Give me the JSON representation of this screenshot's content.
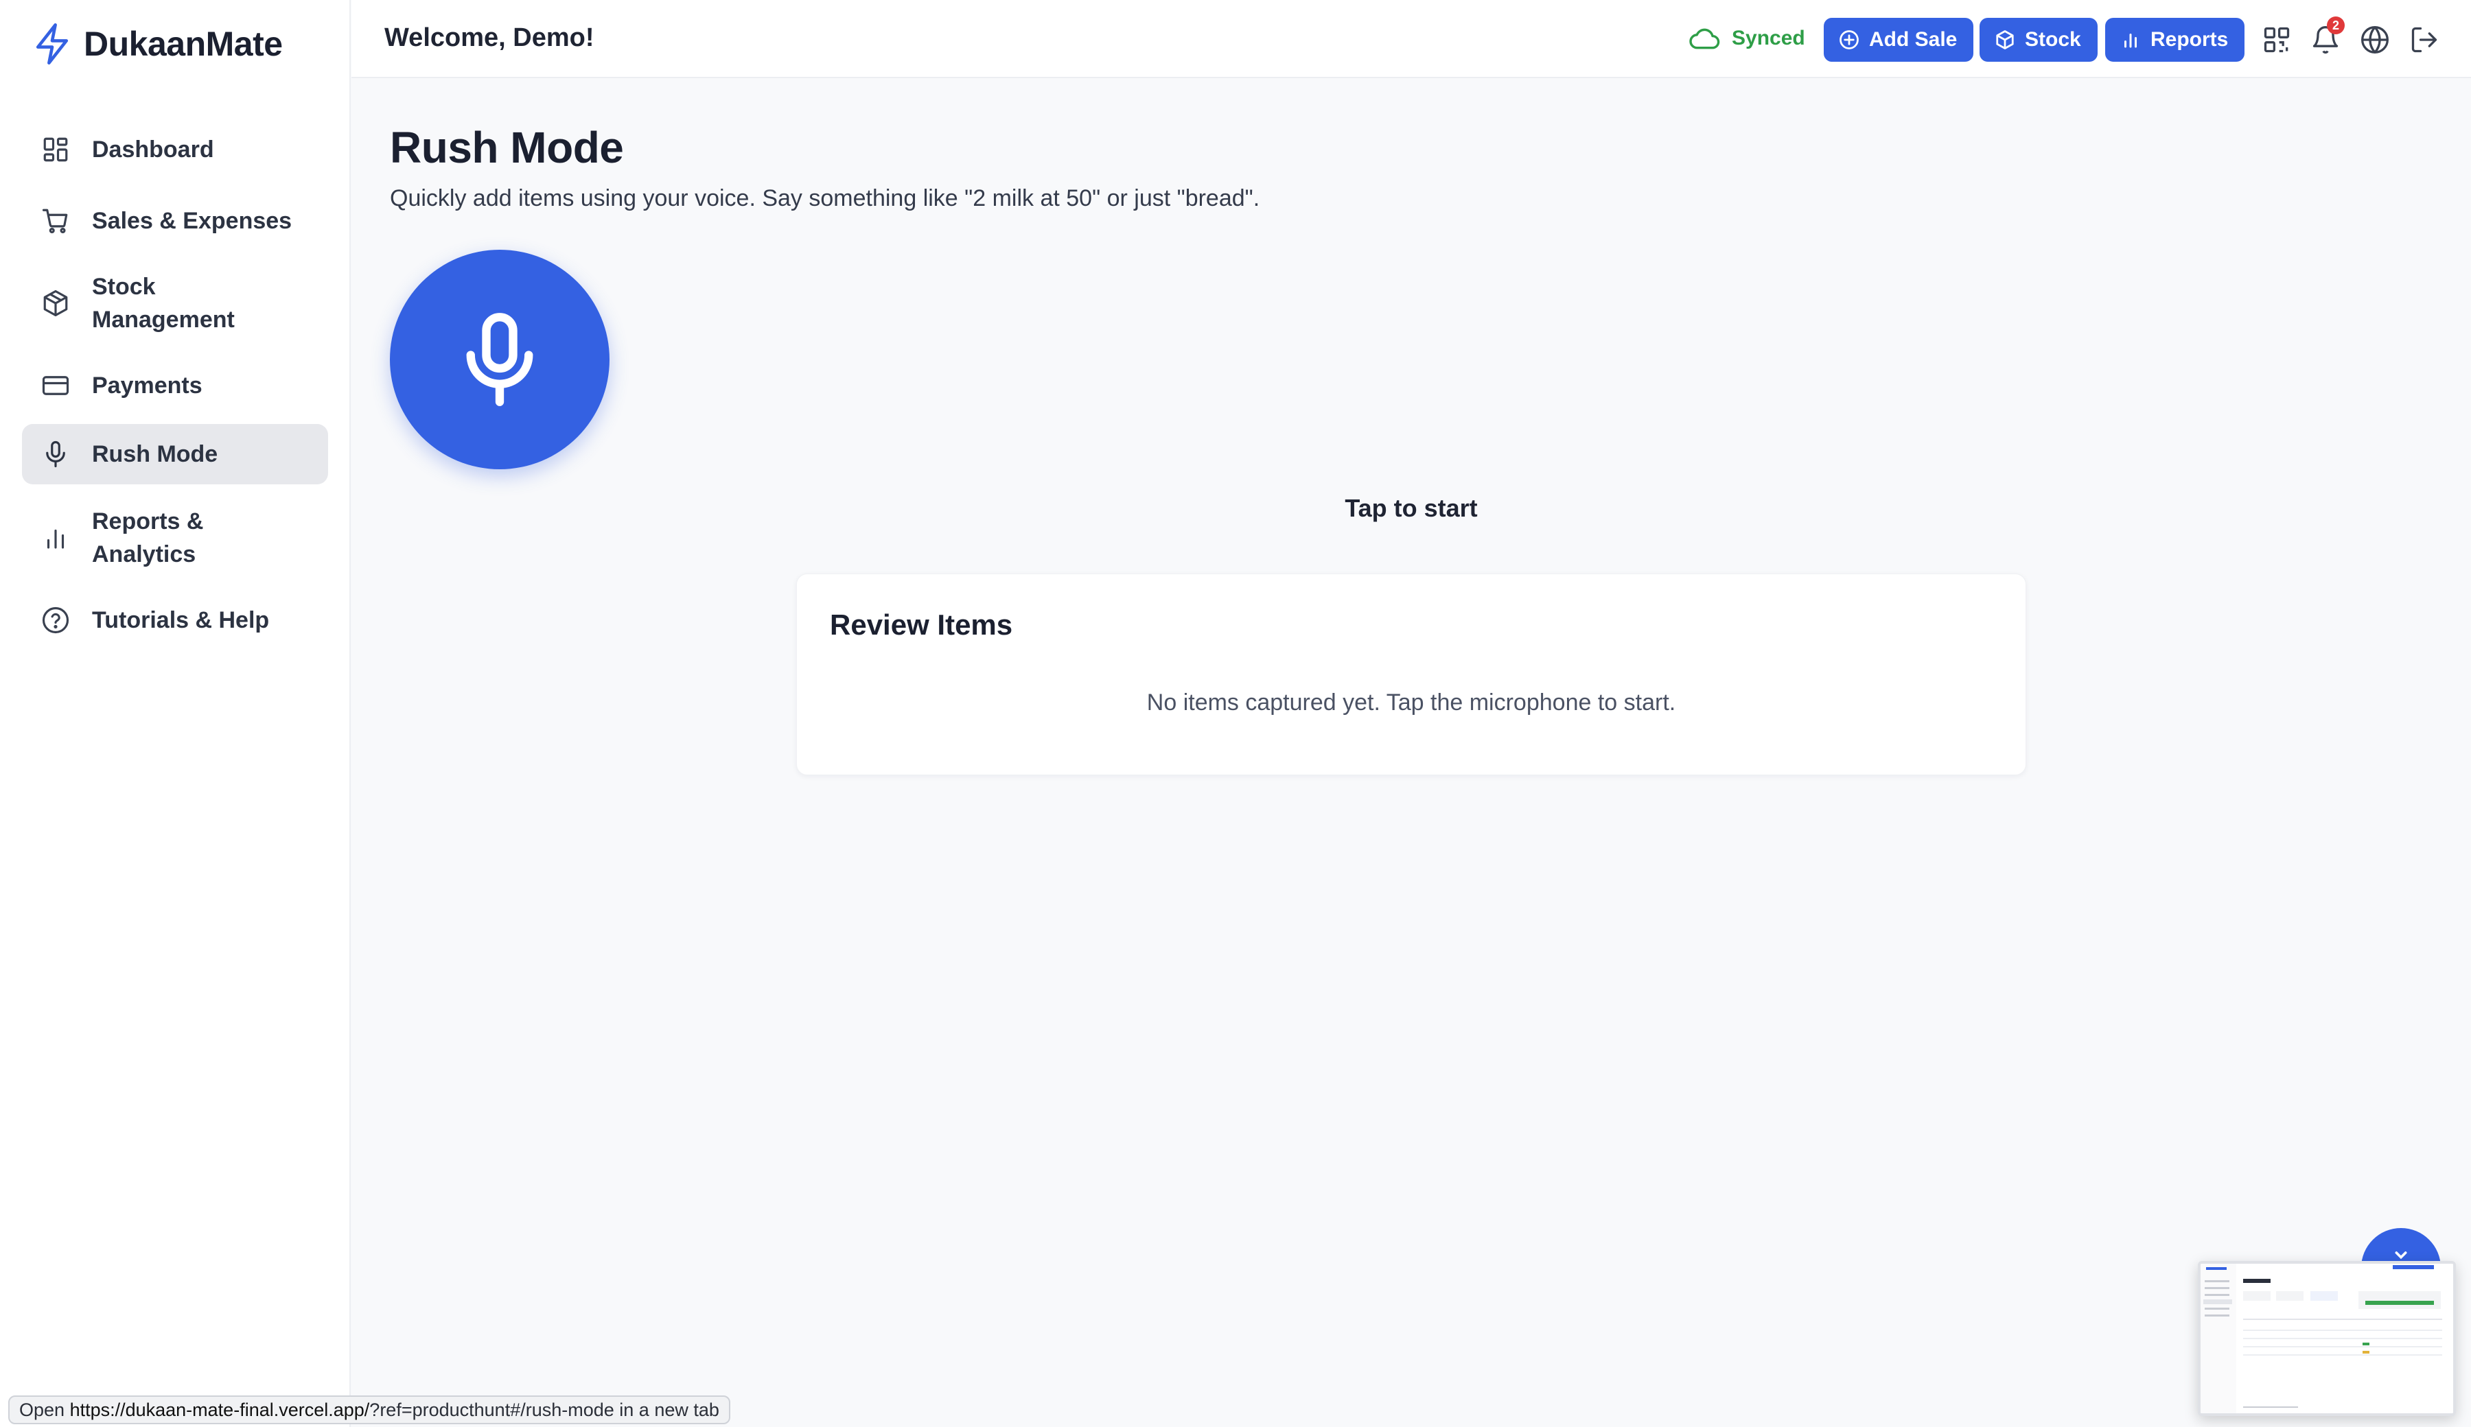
{
  "app": {
    "name": "DukaanMate",
    "logo_icon": "lightning-bolt-icon"
  },
  "colors": {
    "accent": "#3461e2",
    "synced": "#2e9e47",
    "badge": "#e0393a",
    "active_nav_bg": "#e7e8ec"
  },
  "sidebar": {
    "items": [
      {
        "label": "Dashboard",
        "icon": "dashboard-grid-icon"
      },
      {
        "label": "Sales & Expenses",
        "icon": "shopping-cart-icon"
      },
      {
        "label": "Stock Management",
        "icon": "box-icon"
      },
      {
        "label": "Payments",
        "icon": "credit-card-icon"
      },
      {
        "label": "Rush Mode",
        "icon": "microphone-icon",
        "active": true
      },
      {
        "label": "Reports & Analytics",
        "icon": "bar-chart-icon"
      },
      {
        "label": "Tutorials & Help",
        "icon": "help-circle-icon"
      }
    ]
  },
  "header": {
    "welcome": "Welcome, Demo!",
    "sync_status": "Synced",
    "buttons": {
      "add_sale": "Add Sale",
      "stock": "Stock",
      "reports": "Reports"
    },
    "notification_count": "2",
    "icons": [
      "qr-code-icon",
      "bell-icon",
      "globe-icon",
      "logout-icon"
    ]
  },
  "main": {
    "title": "Rush Mode",
    "subtitle": "Quickly add items using your voice. Say something like \"2 milk at 50\" or just \"bread\".",
    "tap_prompt": "Tap to start",
    "review": {
      "title": "Review Items",
      "empty_message": "No items captured yet. Tap the microphone to start."
    }
  },
  "status_bar": {
    "prefix": "Open ",
    "url_host": "https://dukaan-mate-final.vercel.app/",
    "url_rest": "?ref=producthunt#/rush-mode",
    "suffix": " in a new tab"
  }
}
